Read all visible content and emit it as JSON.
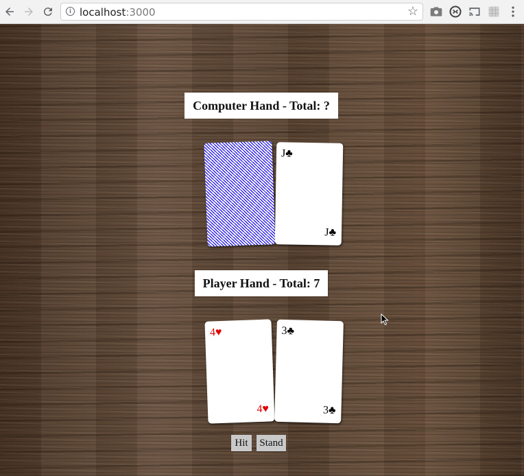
{
  "browser": {
    "url_host": "localhost",
    "url_port": ":3000",
    "icons": [
      "back-icon",
      "forward-icon",
      "reload-icon",
      "info-icon",
      "star-icon",
      "camera-icon",
      "sync-icon",
      "cast-icon",
      "extension-icon",
      "menu-icon"
    ]
  },
  "computer": {
    "title": "Computer Hand - Total: ?",
    "cards": [
      {
        "face_down": true
      },
      {
        "rank": "J",
        "suit": "♣",
        "color": "black"
      }
    ]
  },
  "player": {
    "title": "Player Hand - Total: 7",
    "cards": [
      {
        "rank": "4",
        "suit": "♥",
        "color": "red"
      },
      {
        "rank": "3",
        "suit": "♣",
        "color": "black"
      }
    ]
  },
  "actions": {
    "hit_label": "Hit",
    "stand_label": "Stand"
  },
  "colors": {
    "card_back": "#2a1ff0",
    "red_suit": "#e00000",
    "felt_wood": "#5c4533",
    "button_bg": "#c9c9c9"
  }
}
